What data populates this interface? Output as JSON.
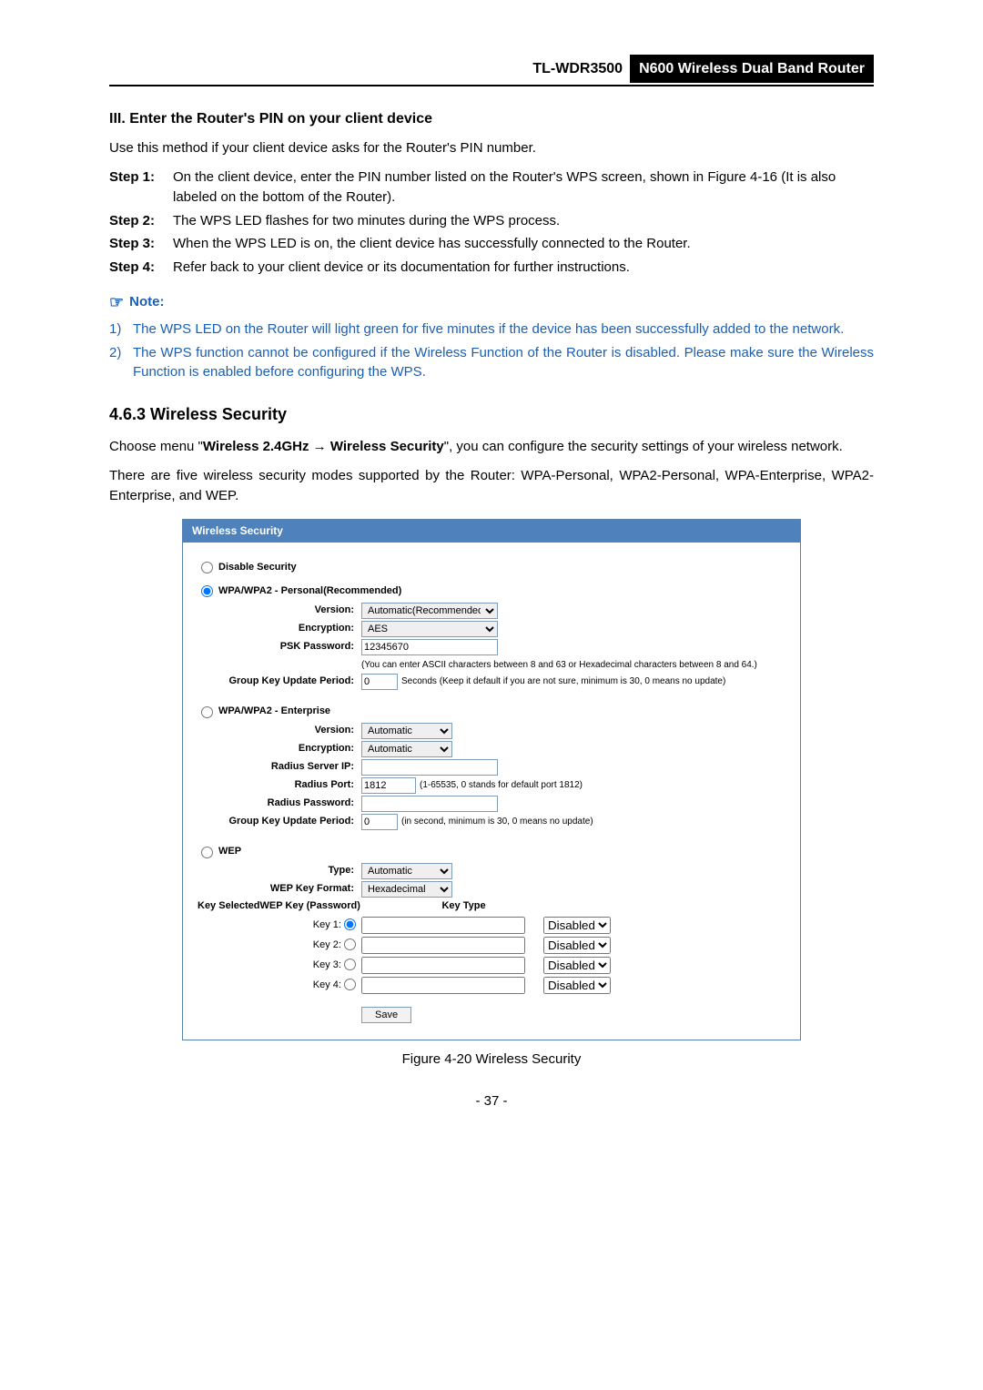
{
  "header": {
    "model": "TL-WDR3500",
    "product": "N600 Wireless Dual Band Router"
  },
  "section3": {
    "title": "III.  Enter the Router's PIN on your client device",
    "intro": "Use this method if your client device asks for the Router's PIN number.",
    "steps": [
      {
        "label": "Step 1:",
        "text": "On the client device, enter the PIN number listed on the Router's WPS screen, shown in Figure 4-16 (It is also labeled on the bottom of the Router)."
      },
      {
        "label": "Step 2:",
        "text": "The WPS LED flashes for two minutes during the WPS process."
      },
      {
        "label": "Step 3:",
        "text": "When the WPS LED is on, the client device has successfully connected to the Router."
      },
      {
        "label": "Step 4:",
        "text": "Refer back to your client device or its documentation for further instructions."
      }
    ],
    "note_label": "Note:",
    "notes": [
      {
        "num": "1)",
        "text": "The WPS LED on the Router will light green for five minutes if the device has been successfully added to the network."
      },
      {
        "num": "2)",
        "text": "The WPS function cannot be configured if the Wireless Function of the Router is disabled. Please make sure the Wireless Function is enabled before configuring the WPS."
      }
    ]
  },
  "section463": {
    "heading": "4.6.3    Wireless Security",
    "para1_pre": "Choose menu \"",
    "para1_bold1": "Wireless 2.4GHz",
    "para1_arrow": " → ",
    "para1_bold2": "Wireless Security",
    "para1_post": "\", you can configure the security settings of your wireless network.",
    "para2": "There are five wireless security modes supported by the Router: WPA-Personal, WPA2-Personal, WPA-Enterprise, WPA2-Enterprise, and WEP."
  },
  "panel": {
    "title": "Wireless Security",
    "opt_disable": "Disable Security",
    "opt_personal": "WPA/WPA2 - Personal(Recommended)",
    "opt_enterprise": "WPA/WPA2 - Enterprise",
    "opt_wep": "WEP",
    "lbl_version": "Version:",
    "lbl_encryption": "Encryption:",
    "lbl_psk": "PSK Password:",
    "lbl_gkup": "Group Key Update Period:",
    "lbl_radius_ip": "Radius Server IP:",
    "lbl_radius_port": "Radius Port:",
    "lbl_radius_pw": "Radius Password:",
    "lbl_type": "Type:",
    "lbl_wep_fmt": "WEP Key Format:",
    "lbl_key_sel": "Key Selected",
    "col_pass": "WEP Key (Password)",
    "col_type": "Key Type",
    "personal": {
      "version": "Automatic(Recommended)",
      "encryption": "AES",
      "psk": "12345670",
      "psk_hint": "(You can enter ASCII characters between 8 and 63 or Hexadecimal characters between 8 and 64.)",
      "gkup": "0",
      "gkup_hint": "Seconds (Keep it default if you are not sure, minimum is 30, 0 means no update)"
    },
    "enterprise": {
      "version": "Automatic",
      "encryption": "Automatic",
      "radius_ip": "",
      "radius_port": "1812",
      "radius_port_hint": "(1-65535, 0 stands for default port 1812)",
      "radius_pw": "",
      "gkup": "0",
      "gkup_hint": "(in second, minimum is 30, 0 means no update)"
    },
    "wep": {
      "type": "Automatic",
      "format": "Hexadecimal",
      "keys": [
        {
          "label": "Key 1:",
          "checked": true,
          "type": "Disabled"
        },
        {
          "label": "Key 2:",
          "checked": false,
          "type": "Disabled"
        },
        {
          "label": "Key 3:",
          "checked": false,
          "type": "Disabled"
        },
        {
          "label": "Key 4:",
          "checked": false,
          "type": "Disabled"
        }
      ]
    },
    "save": "Save"
  },
  "fig_caption": "Figure 4-20 Wireless Security",
  "page_num": "- 37 -"
}
